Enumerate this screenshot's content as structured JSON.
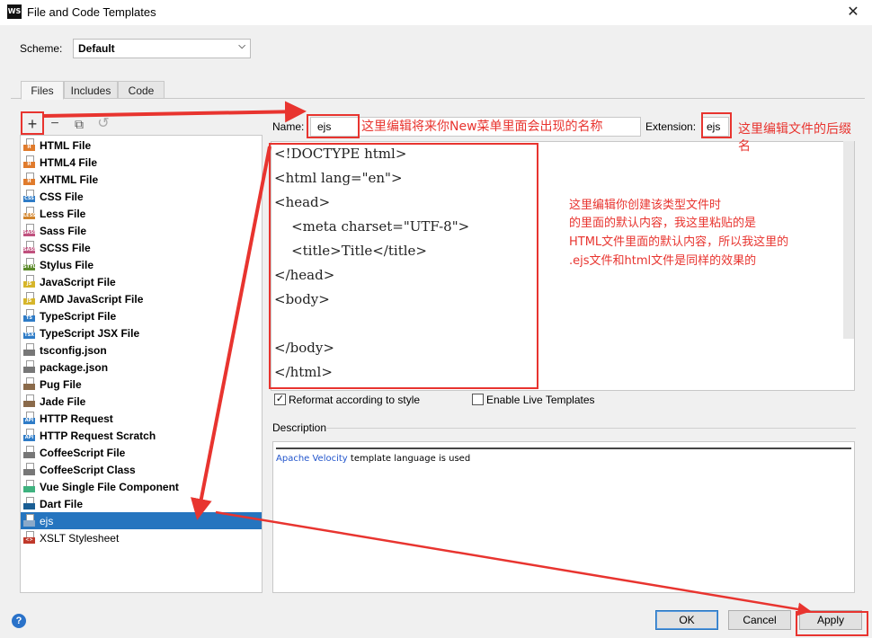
{
  "window": {
    "app_logo": "WS",
    "title": "File and Code Templates",
    "close_glyph": "✕"
  },
  "scheme": {
    "label": "Scheme:",
    "value": "Default"
  },
  "tabs": [
    {
      "label": "Files",
      "active": true
    },
    {
      "label": "Includes",
      "active": false
    },
    {
      "label": "Code",
      "active": false
    }
  ],
  "toolbar": {
    "add": "+",
    "remove": "−",
    "copy": "⧉",
    "reset": "↺"
  },
  "file_list": [
    {
      "label": "HTML File",
      "icon": "html-icon",
      "tag": "H",
      "color": "#e07b2c"
    },
    {
      "label": "HTML4 File",
      "icon": "html-icon",
      "tag": "H",
      "color": "#e07b2c"
    },
    {
      "label": "XHTML File",
      "icon": "html-icon",
      "tag": "H",
      "color": "#e07b2c"
    },
    {
      "label": "CSS File",
      "icon": "css-icon",
      "tag": "CSS",
      "color": "#2f7cc7"
    },
    {
      "label": "Less File",
      "icon": "less-icon",
      "tag": "LESS",
      "color": "#d1842c"
    },
    {
      "label": "Sass File",
      "icon": "sass-icon",
      "tag": "SASS",
      "color": "#c0517e"
    },
    {
      "label": "SCSS File",
      "icon": "scss-icon",
      "tag": "SASS",
      "color": "#c0517e"
    },
    {
      "label": "Stylus File",
      "icon": "stylus-icon",
      "tag": "STYL",
      "color": "#5b8a2a"
    },
    {
      "label": "JavaScript File",
      "icon": "js-icon",
      "tag": "JS",
      "color": "#d6b52a"
    },
    {
      "label": "AMD JavaScript File",
      "icon": "js-icon",
      "tag": "JS",
      "color": "#d6b52a"
    },
    {
      "label": "TypeScript File",
      "icon": "ts-icon",
      "tag": "TS",
      "color": "#2f7cc7"
    },
    {
      "label": "TypeScript JSX File",
      "icon": "tsx-icon",
      "tag": "TSX",
      "color": "#2f7cc7"
    },
    {
      "label": "tsconfig.json",
      "icon": "json-icon",
      "tag": "",
      "color": "#777777"
    },
    {
      "label": "package.json",
      "icon": "json-icon",
      "tag": "",
      "color": "#777777"
    },
    {
      "label": "Pug File",
      "icon": "pug-icon",
      "tag": "",
      "color": "#8a6a4a"
    },
    {
      "label": "Jade File",
      "icon": "jade-icon",
      "tag": "",
      "color": "#8a6a4a"
    },
    {
      "label": "HTTP Request",
      "icon": "api-icon",
      "tag": "API",
      "color": "#2f7cc7"
    },
    {
      "label": "HTTP Request Scratch",
      "icon": "api-icon",
      "tag": "API",
      "color": "#2f7cc7"
    },
    {
      "label": "CoffeeScript File",
      "icon": "coffee-icon",
      "tag": "",
      "color": "#777777"
    },
    {
      "label": "CoffeeScript Class",
      "icon": "coffee-icon",
      "tag": "",
      "color": "#777777"
    },
    {
      "label": "Vue Single File Component",
      "icon": "vue-icon",
      "tag": "",
      "color": "#3fb27f"
    },
    {
      "label": "Dart File",
      "icon": "dart-icon",
      "tag": "",
      "color": "#1a5e94"
    },
    {
      "label": "ejs",
      "icon": "ejs-icon",
      "tag": "",
      "color": "#8aa9c9",
      "selected": true,
      "plain": true
    },
    {
      "label": "XSLT Stylesheet",
      "icon": "xml-icon",
      "tag": "<>",
      "color": "#c0392b",
      "plain": true
    }
  ],
  "name_field": {
    "label": "Name:",
    "value": "ejs"
  },
  "extension_field": {
    "label": "Extension:",
    "value": "ejs"
  },
  "code_lines": [
    "<!DOCTYPE html>",
    "<html lang=\"en\">",
    "<head>",
    "    <meta charset=\"UTF-8\">",
    "    <title>Title</title>",
    "</head>",
    "<body>",
    "",
    "</body>",
    "</html>"
  ],
  "options": {
    "reformat": {
      "label": "Reformat according to style",
      "checked": true
    },
    "live_templates": {
      "label": "Enable Live Templates",
      "checked": false
    }
  },
  "description": {
    "label": "Description",
    "link_text": "Apache Velocity",
    "rest_text": " template language is used"
  },
  "buttons": {
    "help": "?",
    "ok": "OK",
    "cancel": "Cancel",
    "apply": "Apply"
  },
  "annotations": {
    "name_note": "这里编辑将来你New菜单里面会出现的名称",
    "ext_note_line1": "这里编辑文件的后缀",
    "ext_note_line2": "名",
    "content_note": [
      "这里编辑你创建该类型文件时",
      "的里面的默认内容，我这里粘贴的是",
      "HTML文件里面的默认内容，所以我这里的",
      ".ejs文件和html文件是同样的效果的"
    ],
    "color": "#e8342f"
  }
}
